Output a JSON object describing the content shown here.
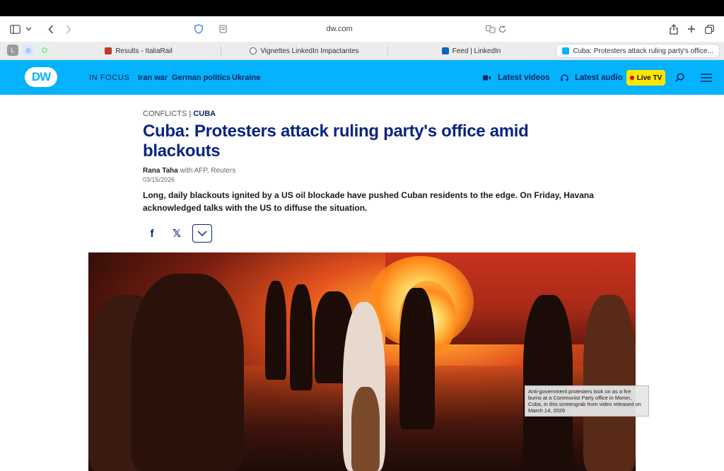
{
  "browser": {
    "url": "dw.com",
    "tabs": [
      {
        "label": "Results - ItaliaRail",
        "favicon_color": "#c0392b"
      },
      {
        "label": "Vignettes LinkedIn Impactantes",
        "favicon_color": "#555555"
      },
      {
        "label": "Feed | LinkedIn",
        "favicon_color": "#0a66c2"
      },
      {
        "label": "Cuba: Protesters attack ruling party's office...",
        "favicon_color": "#05b2fc"
      }
    ],
    "pinned": [
      {
        "label": "L",
        "color": "#8a8a8a"
      },
      {
        "label": "◎",
        "color": "#3b82f6"
      },
      {
        "label": "⬡",
        "color": "#16a34a"
      }
    ]
  },
  "site": {
    "logo": "DW",
    "nav_in_focus": "IN FOCUS",
    "nav_items": [
      "Iran war",
      "German politics",
      "Ukraine"
    ],
    "latest_videos": "Latest videos",
    "latest_audio": "Latest audio",
    "live_tv": "Live TV",
    "brand_color": "#05b2fc"
  },
  "article": {
    "kicker_section": "CONFLICTS",
    "kicker_sep": " | ",
    "kicker_topic": "CUBA",
    "headline": "Cuba: Protesters attack ruling party's office amid blackouts",
    "author": "Rana Taha",
    "with": " with AFP, Reuters",
    "date": "03/15/2026",
    "lead": "Long, daily blackouts ignited by a US oil blockade have pushed Cuban residents to the edge. On Friday, Havana acknowledged talks with the US to diffuse the situation.",
    "share": {
      "facebook": "f",
      "x": "𝕏"
    },
    "image_caption": "Anti-government protesters look on as a fire burns at a Communist Party office in Moron, Cuba, in this screengrab from video released on March 14, 2026"
  }
}
